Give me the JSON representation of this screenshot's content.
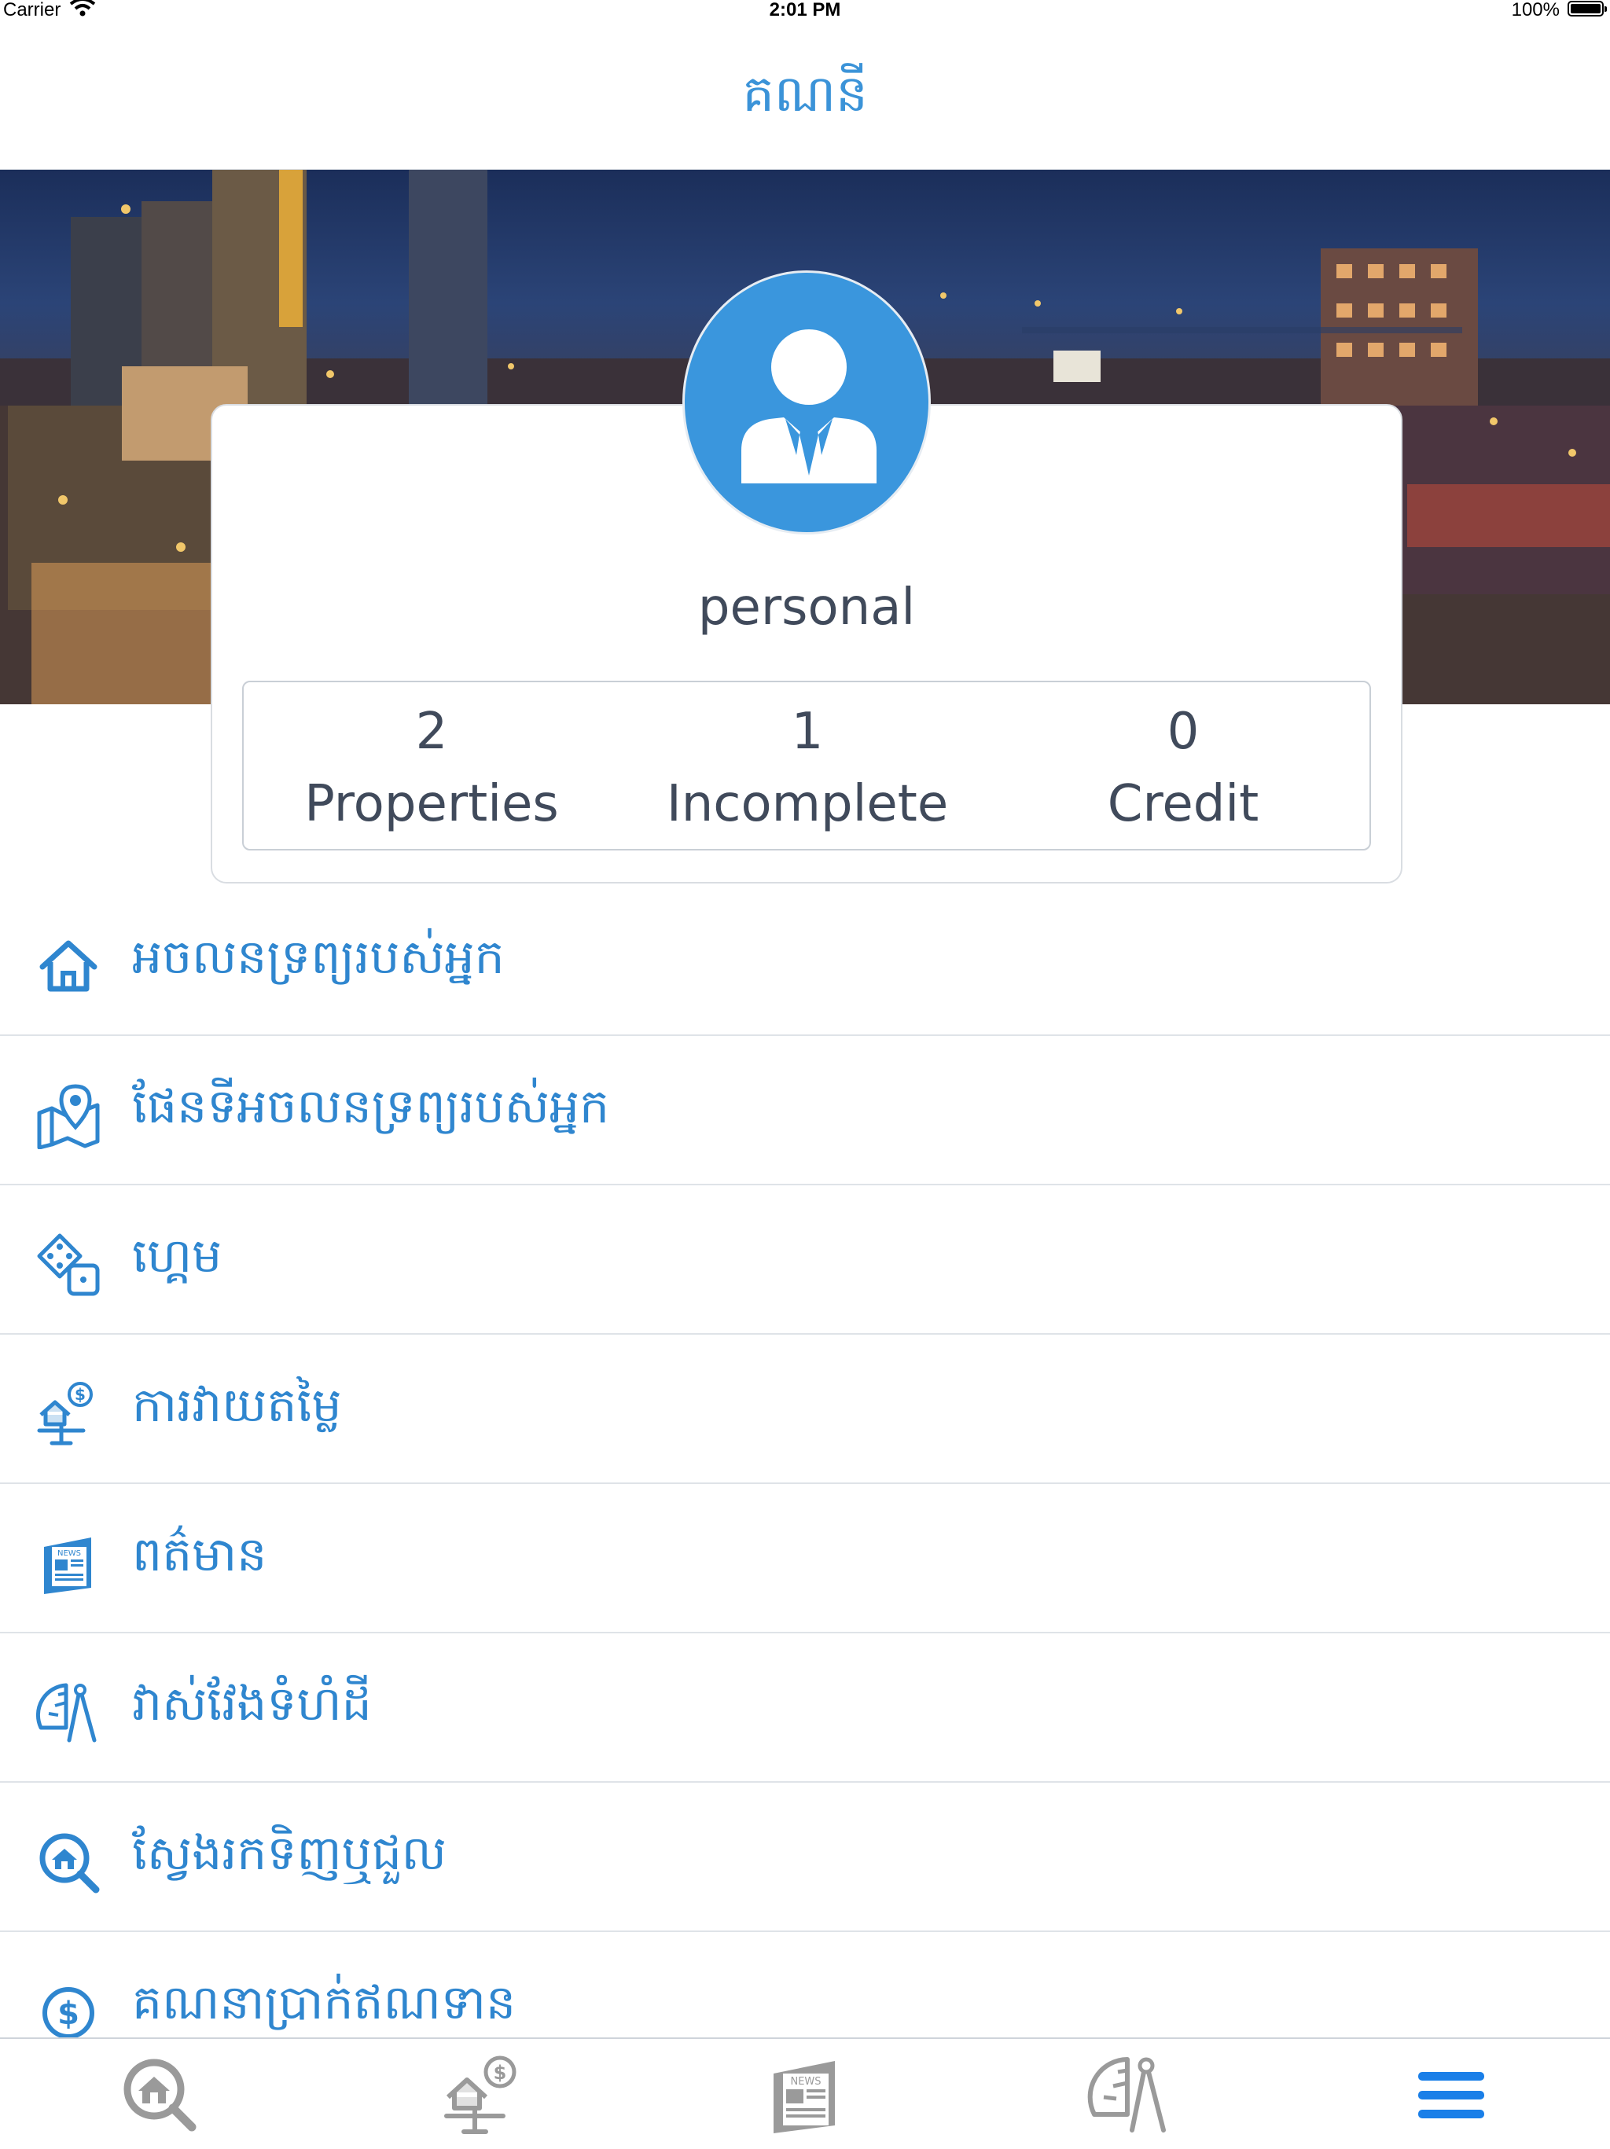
{
  "status_bar": {
    "carrier": "Carrier",
    "time": "2:01 PM",
    "battery": "100%"
  },
  "header": {
    "title": "គណនី"
  },
  "profile": {
    "name": "personal",
    "stats": [
      {
        "value": "2",
        "label": "Properties"
      },
      {
        "value": "1",
        "label": "Incomplete"
      },
      {
        "value": "0",
        "label": "Credit"
      }
    ]
  },
  "menu": {
    "items": [
      {
        "label": "អចលនទ្រព្យរបស់អ្នក",
        "icon": "home-icon"
      },
      {
        "label": "ផែនទីអចលនទ្រព្យរបស់អ្នក",
        "icon": "map-pin-icon"
      },
      {
        "label": "ហ្គេម",
        "icon": "dice-icon"
      },
      {
        "label": "ការវាយតម្លៃ",
        "icon": "valuation-icon"
      },
      {
        "label": "ពត៌មាន",
        "icon": "news-icon"
      },
      {
        "label": "វាស់វែងទំហំដី",
        "icon": "land-measure-icon"
      },
      {
        "label": "ស្វែងរកទិញឬជួល",
        "icon": "search-home-icon"
      },
      {
        "label": "គណនាប្រាក់ឥណទាន",
        "icon": "dollar-icon"
      }
    ]
  },
  "tab_bar": {
    "items": [
      {
        "icon": "search-home-icon"
      },
      {
        "icon": "valuation-icon"
      },
      {
        "icon": "news-icon",
        "text": "NEWS"
      },
      {
        "icon": "land-measure-icon"
      },
      {
        "icon": "hamburger-menu-icon"
      }
    ],
    "active_color": "#1a7fe8",
    "inactive_color": "#9a9a9a"
  },
  "colors": {
    "accent": "#3b93d8",
    "text": "#404a5b"
  }
}
